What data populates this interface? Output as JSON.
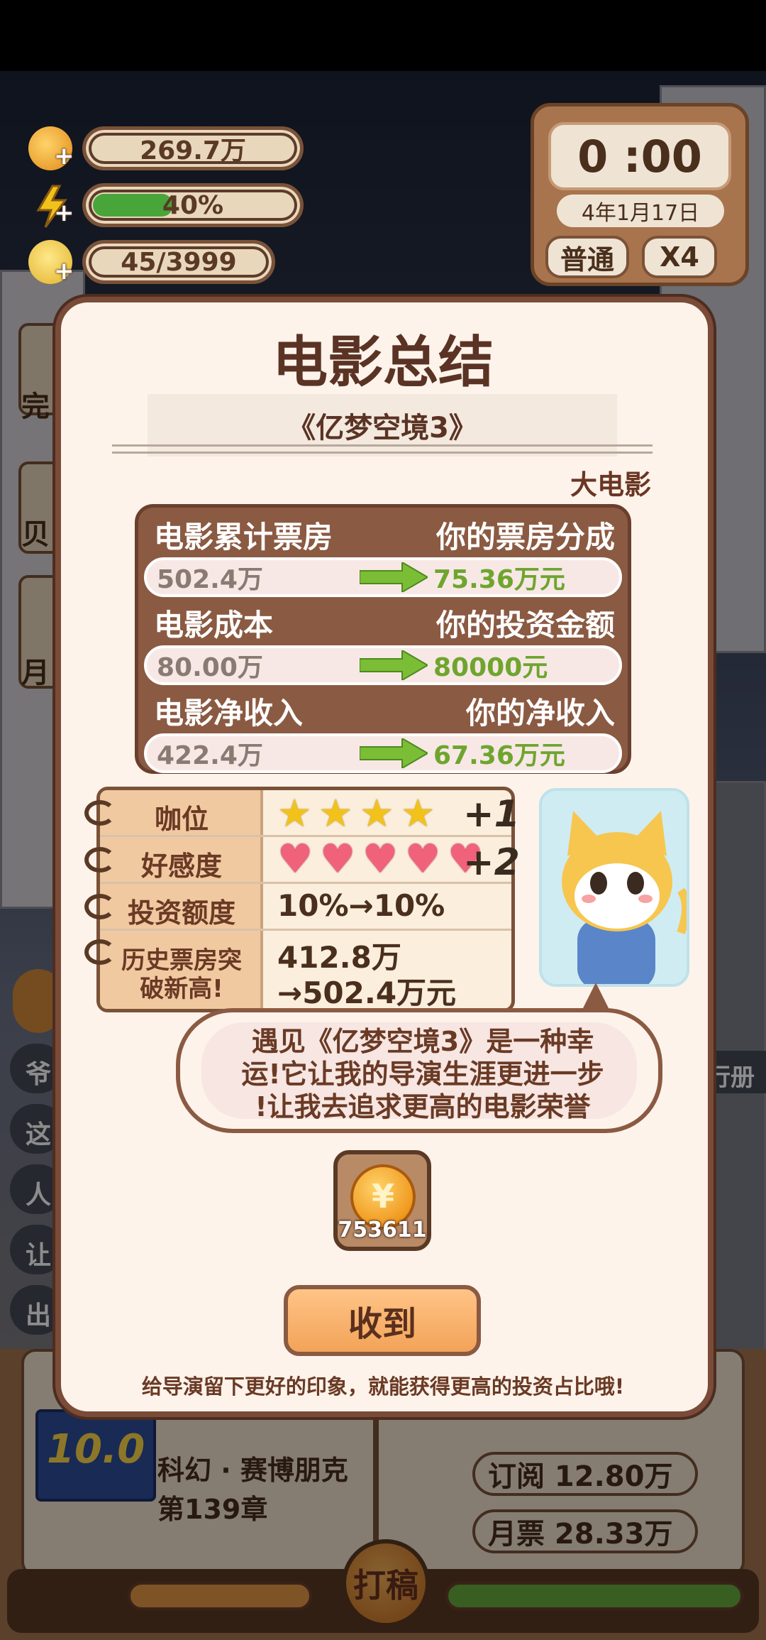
{
  "hud": {
    "coins": "269.7万",
    "energy": "40%",
    "energy_fraction": 0.4,
    "ideas": "45/3999"
  },
  "clock": {
    "time": "0 :00",
    "date": "4年1月17日",
    "mode": "普通",
    "speed": "X4"
  },
  "modal": {
    "title": "电影总结",
    "movie_name": "《亿梦空境3》",
    "tag": "大电影",
    "stats": [
      {
        "left_label": "电影累计票房",
        "right_label": "你的票房分成",
        "left_value": "502.4万",
        "right_value": "75.36万元"
      },
      {
        "left_label": "电影成本",
        "right_label": "你的投资金额",
        "left_value": "80.00万",
        "right_value": "80000元"
      },
      {
        "left_label": "电影净收入",
        "right_label": "你的净收入",
        "left_value": "422.4万",
        "right_value": "67.36万元"
      }
    ],
    "notes": {
      "rank_label": "咖位",
      "rank_stars": 4,
      "rank_gain": "+1",
      "favor_label": "好感度",
      "favor_hearts": 5,
      "favor_gain": "+2",
      "invest_label": "投资额度",
      "invest_value": "10%→10%",
      "record_label_1": "历史票房突",
      "record_label_2": "破新高!",
      "record_value_1": "412.8万",
      "record_value_2": "→502.4万元"
    },
    "quote_line_1": "遇见《亿梦空境3》是一种幸",
    "quote_line_2": "运!它让我的导演生涯更进一步",
    "quote_line_3": "!让我去追求更高的电影荣誉",
    "reward_amount": "753611",
    "collect_label": "收到",
    "hint": "给导演留下更好的印象，就能获得更高的投资占比哦!"
  },
  "background": {
    "book_rating": "10.0",
    "book_genre": "科幻 · 赛博朋克",
    "book_chapter": "第139章",
    "subscribe": "订阅 12.80万",
    "monthly_ticket": "月票 28.33万",
    "draft_button": "打稿",
    "side_label": "行册",
    "left_chars": [
      "完",
      "贝",
      "月",
      "爷",
      "这",
      "人",
      "让",
      "出"
    ]
  },
  "colors": {
    "modal_bg": "#fdf3ea",
    "modal_border": "#7a4b38",
    "accent_green": "#6fa52e",
    "collect_orange": "#f2a358"
  }
}
